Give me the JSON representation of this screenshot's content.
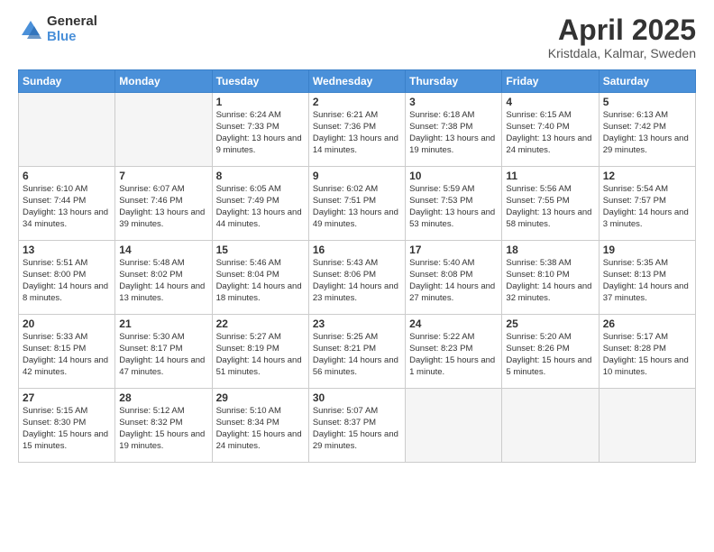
{
  "header": {
    "logo_general": "General",
    "logo_blue": "Blue",
    "title": "April 2025",
    "subtitle": "Kristdala, Kalmar, Sweden"
  },
  "weekdays": [
    "Sunday",
    "Monday",
    "Tuesday",
    "Wednesday",
    "Thursday",
    "Friday",
    "Saturday"
  ],
  "weeks": [
    [
      {
        "day": "",
        "info": ""
      },
      {
        "day": "",
        "info": ""
      },
      {
        "day": "1",
        "info": "Sunrise: 6:24 AM\nSunset: 7:33 PM\nDaylight: 13 hours and 9 minutes."
      },
      {
        "day": "2",
        "info": "Sunrise: 6:21 AM\nSunset: 7:36 PM\nDaylight: 13 hours and 14 minutes."
      },
      {
        "day": "3",
        "info": "Sunrise: 6:18 AM\nSunset: 7:38 PM\nDaylight: 13 hours and 19 minutes."
      },
      {
        "day": "4",
        "info": "Sunrise: 6:15 AM\nSunset: 7:40 PM\nDaylight: 13 hours and 24 minutes."
      },
      {
        "day": "5",
        "info": "Sunrise: 6:13 AM\nSunset: 7:42 PM\nDaylight: 13 hours and 29 minutes."
      }
    ],
    [
      {
        "day": "6",
        "info": "Sunrise: 6:10 AM\nSunset: 7:44 PM\nDaylight: 13 hours and 34 minutes."
      },
      {
        "day": "7",
        "info": "Sunrise: 6:07 AM\nSunset: 7:46 PM\nDaylight: 13 hours and 39 minutes."
      },
      {
        "day": "8",
        "info": "Sunrise: 6:05 AM\nSunset: 7:49 PM\nDaylight: 13 hours and 44 minutes."
      },
      {
        "day": "9",
        "info": "Sunrise: 6:02 AM\nSunset: 7:51 PM\nDaylight: 13 hours and 49 minutes."
      },
      {
        "day": "10",
        "info": "Sunrise: 5:59 AM\nSunset: 7:53 PM\nDaylight: 13 hours and 53 minutes."
      },
      {
        "day": "11",
        "info": "Sunrise: 5:56 AM\nSunset: 7:55 PM\nDaylight: 13 hours and 58 minutes."
      },
      {
        "day": "12",
        "info": "Sunrise: 5:54 AM\nSunset: 7:57 PM\nDaylight: 14 hours and 3 minutes."
      }
    ],
    [
      {
        "day": "13",
        "info": "Sunrise: 5:51 AM\nSunset: 8:00 PM\nDaylight: 14 hours and 8 minutes."
      },
      {
        "day": "14",
        "info": "Sunrise: 5:48 AM\nSunset: 8:02 PM\nDaylight: 14 hours and 13 minutes."
      },
      {
        "day": "15",
        "info": "Sunrise: 5:46 AM\nSunset: 8:04 PM\nDaylight: 14 hours and 18 minutes."
      },
      {
        "day": "16",
        "info": "Sunrise: 5:43 AM\nSunset: 8:06 PM\nDaylight: 14 hours and 23 minutes."
      },
      {
        "day": "17",
        "info": "Sunrise: 5:40 AM\nSunset: 8:08 PM\nDaylight: 14 hours and 27 minutes."
      },
      {
        "day": "18",
        "info": "Sunrise: 5:38 AM\nSunset: 8:10 PM\nDaylight: 14 hours and 32 minutes."
      },
      {
        "day": "19",
        "info": "Sunrise: 5:35 AM\nSunset: 8:13 PM\nDaylight: 14 hours and 37 minutes."
      }
    ],
    [
      {
        "day": "20",
        "info": "Sunrise: 5:33 AM\nSunset: 8:15 PM\nDaylight: 14 hours and 42 minutes."
      },
      {
        "day": "21",
        "info": "Sunrise: 5:30 AM\nSunset: 8:17 PM\nDaylight: 14 hours and 47 minutes."
      },
      {
        "day": "22",
        "info": "Sunrise: 5:27 AM\nSunset: 8:19 PM\nDaylight: 14 hours and 51 minutes."
      },
      {
        "day": "23",
        "info": "Sunrise: 5:25 AM\nSunset: 8:21 PM\nDaylight: 14 hours and 56 minutes."
      },
      {
        "day": "24",
        "info": "Sunrise: 5:22 AM\nSunset: 8:23 PM\nDaylight: 15 hours and 1 minute."
      },
      {
        "day": "25",
        "info": "Sunrise: 5:20 AM\nSunset: 8:26 PM\nDaylight: 15 hours and 5 minutes."
      },
      {
        "day": "26",
        "info": "Sunrise: 5:17 AM\nSunset: 8:28 PM\nDaylight: 15 hours and 10 minutes."
      }
    ],
    [
      {
        "day": "27",
        "info": "Sunrise: 5:15 AM\nSunset: 8:30 PM\nDaylight: 15 hours and 15 minutes."
      },
      {
        "day": "28",
        "info": "Sunrise: 5:12 AM\nSunset: 8:32 PM\nDaylight: 15 hours and 19 minutes."
      },
      {
        "day": "29",
        "info": "Sunrise: 5:10 AM\nSunset: 8:34 PM\nDaylight: 15 hours and 24 minutes."
      },
      {
        "day": "30",
        "info": "Sunrise: 5:07 AM\nSunset: 8:37 PM\nDaylight: 15 hours and 29 minutes."
      },
      {
        "day": "",
        "info": ""
      },
      {
        "day": "",
        "info": ""
      },
      {
        "day": "",
        "info": ""
      }
    ]
  ]
}
